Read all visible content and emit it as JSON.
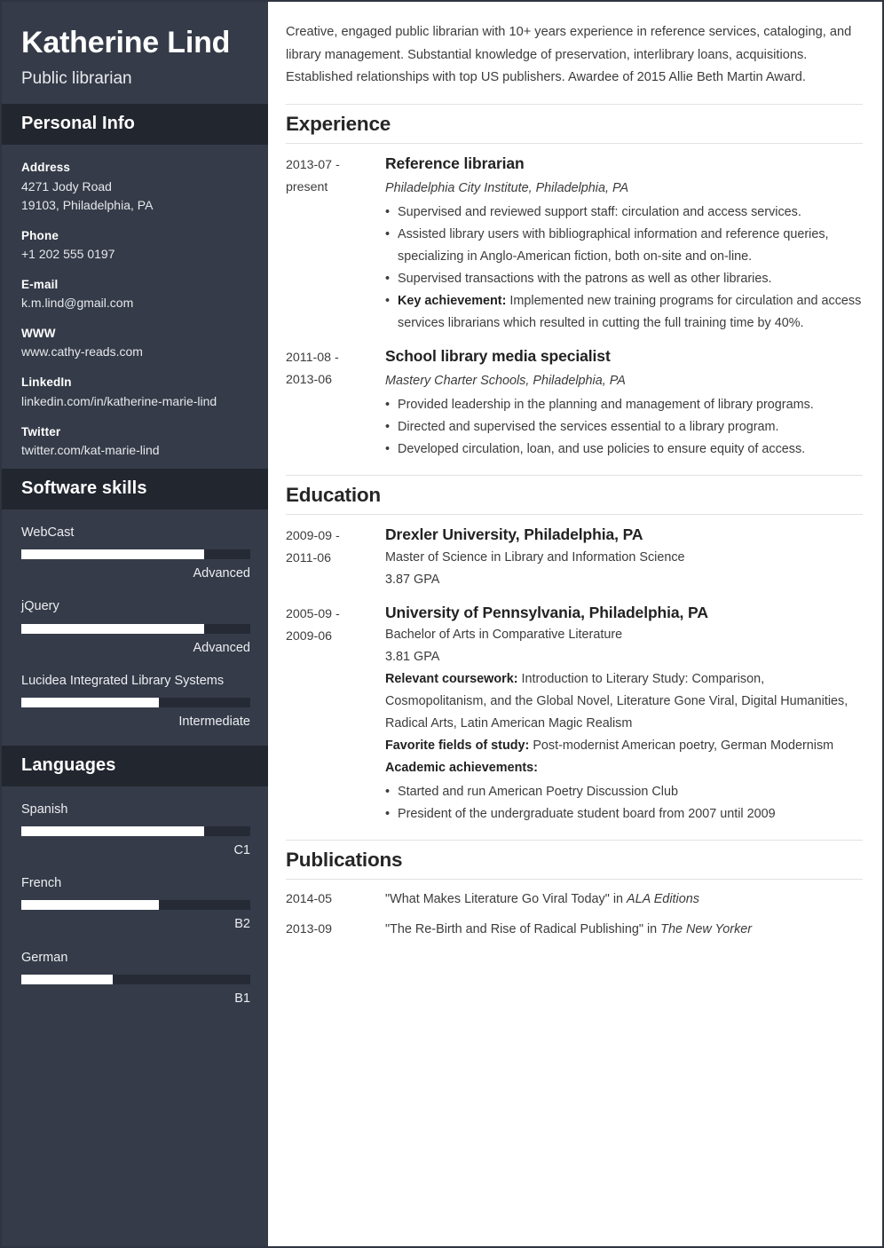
{
  "sidebar": {
    "full_name": "Katherine Lind",
    "job_title": "Public librarian",
    "personal_info": {
      "heading": "Personal Info",
      "fields": [
        {
          "label": "Address",
          "value": "4271 Jody Road",
          "value2": "19103, Philadelphia, PA"
        },
        {
          "label": "Phone",
          "value": "+1 202 555 0197"
        },
        {
          "label": "E-mail",
          "value": "k.m.lind@gmail.com"
        },
        {
          "label": "WWW",
          "value": "www.cathy-reads.com"
        },
        {
          "label": "LinkedIn",
          "value": "linkedin.com/in/katherine-marie-lind"
        },
        {
          "label": "Twitter",
          "value": "twitter.com/kat-marie-lind"
        }
      ]
    },
    "software_skills": {
      "heading": "Software skills",
      "items": [
        {
          "name": "WebCast",
          "level": "Advanced",
          "percent": 80
        },
        {
          "name": "jQuery",
          "level": "Advanced",
          "percent": 80
        },
        {
          "name": "Lucidea Integrated Library Systems",
          "level": "Intermediate",
          "percent": 60
        }
      ]
    },
    "languages": {
      "heading": "Languages",
      "items": [
        {
          "name": "Spanish",
          "level": "C1",
          "percent": 80
        },
        {
          "name": "French",
          "level": "B2",
          "percent": 60
        },
        {
          "name": "German",
          "level": "B1",
          "percent": 40
        }
      ]
    }
  },
  "main": {
    "summary": "Creative, engaged public librarian with 10+ years experience in reference services, cataloging, and library management. Substantial knowledge of preservation, interlibrary loans, acquisitions. Established relationships with top US publishers. Awardee of 2015 Allie Beth Martin Award.",
    "experience": {
      "heading": "Experience",
      "entries": [
        {
          "date_from": "2013-07 -",
          "date_to": "present",
          "title": "Reference librarian",
          "subtitle": "Philadelphia City Institute, Philadelphia, PA",
          "bullets": [
            {
              "text": "Supervised and reviewed support staff: circulation and access services."
            },
            {
              "text": "Assisted library users with bibliographical information and reference queries, specializing in Anglo-American fiction, both on-site and on-line."
            },
            {
              "text": "Supervised transactions with the patrons as well as other libraries."
            },
            {
              "bold": "Key achievement:",
              "text": " Implemented new training programs for circulation and access services librarians which resulted in cutting the full training time by 40%."
            }
          ]
        },
        {
          "date_from": "2011-08 -",
          "date_to": "2013-06",
          "title": "School library media specialist",
          "subtitle": "Mastery Charter Schools, Philadelphia, PA",
          "bullets": [
            {
              "text": "Provided leadership in the planning and management of library programs."
            },
            {
              "text": "Directed and supervised the services essential to a library program."
            },
            {
              "text": "Developed circulation, loan, and use policies to ensure equity of access."
            }
          ]
        }
      ]
    },
    "education": {
      "heading": "Education",
      "entries": [
        {
          "date_from": "2009-09 -",
          "date_to": "2011-06",
          "title": "Drexler University, Philadelphia, PA",
          "degree": "Master of Science in Library and Information Science",
          "gpa": "3.87 GPA"
        },
        {
          "date_from": "2005-09 -",
          "date_to": "2009-06",
          "title": "University of Pennsylvania, Philadelphia, PA",
          "degree": "Bachelor of Arts in Comparative Literature",
          "gpa": "3.81 GPA",
          "coursework_label": "Relevant coursework:",
          "coursework_value": " Introduction to Literary Study: Comparison, Cosmopolitanism, and the Global Novel, Literature Gone Viral, Digital Humanities, Radical Arts, Latin American Magic Realism",
          "favorite_label": "Favorite fields of study:",
          "favorite_value": " Post-modernist American poetry, German Modernism",
          "achievements_label": "Academic achievements:",
          "achievements": [
            "Started and run American Poetry Discussion Club",
            "President of the undergraduate student board from 2007 until 2009"
          ]
        }
      ]
    },
    "publications": {
      "heading": "Publications",
      "entries": [
        {
          "date": "2014-05",
          "prefix": "\"What Makes Literature Go Viral Today\" in ",
          "italic": "ALA Editions"
        },
        {
          "date": "2013-09",
          "prefix": "\"The Re-Birth and Rise of Radical Publishing\" in ",
          "italic": "The New Yorker"
        }
      ]
    }
  }
}
